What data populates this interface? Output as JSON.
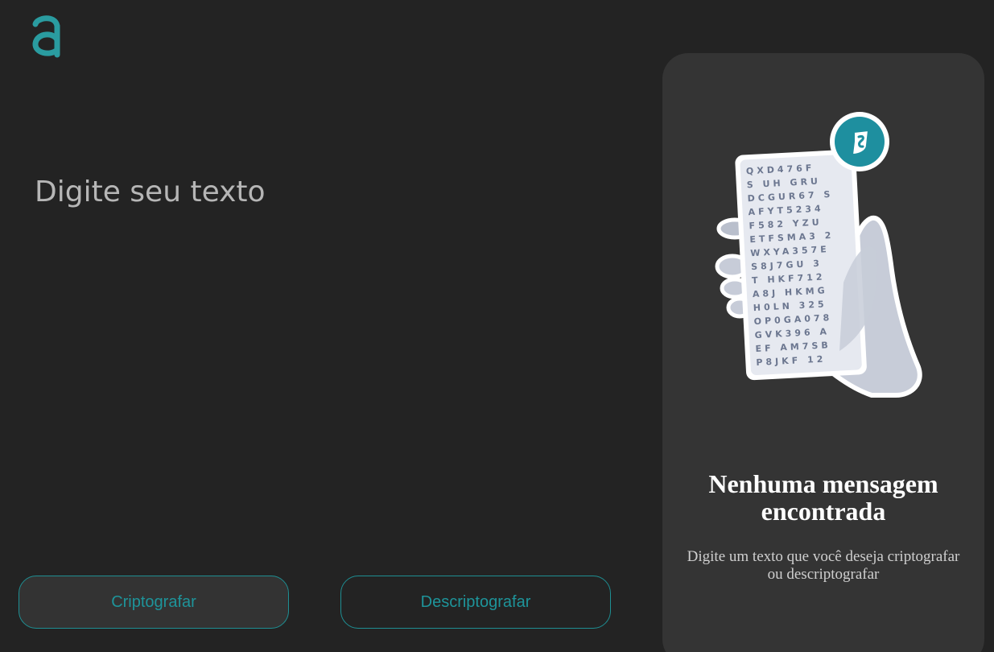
{
  "input": {
    "placeholder": "Digite seu texto",
    "value": ""
  },
  "buttons": {
    "encrypt_label": "Criptografar",
    "decrypt_label": "Descriptografar"
  },
  "output_panel": {
    "title": "Nenhuma mensagem encontrada",
    "subtitle": "Digite um texto que você deseja criptografar ou descriptografar"
  },
  "colors": {
    "background": "#232323",
    "panel": "#343434",
    "accent": "#1e8f93",
    "logo": "#2a9ca0"
  },
  "icons": {
    "logo": "alura-a-logo",
    "illustration": "hand-holding-letter-grid-icon",
    "badge": "shield-s-badge-icon"
  }
}
